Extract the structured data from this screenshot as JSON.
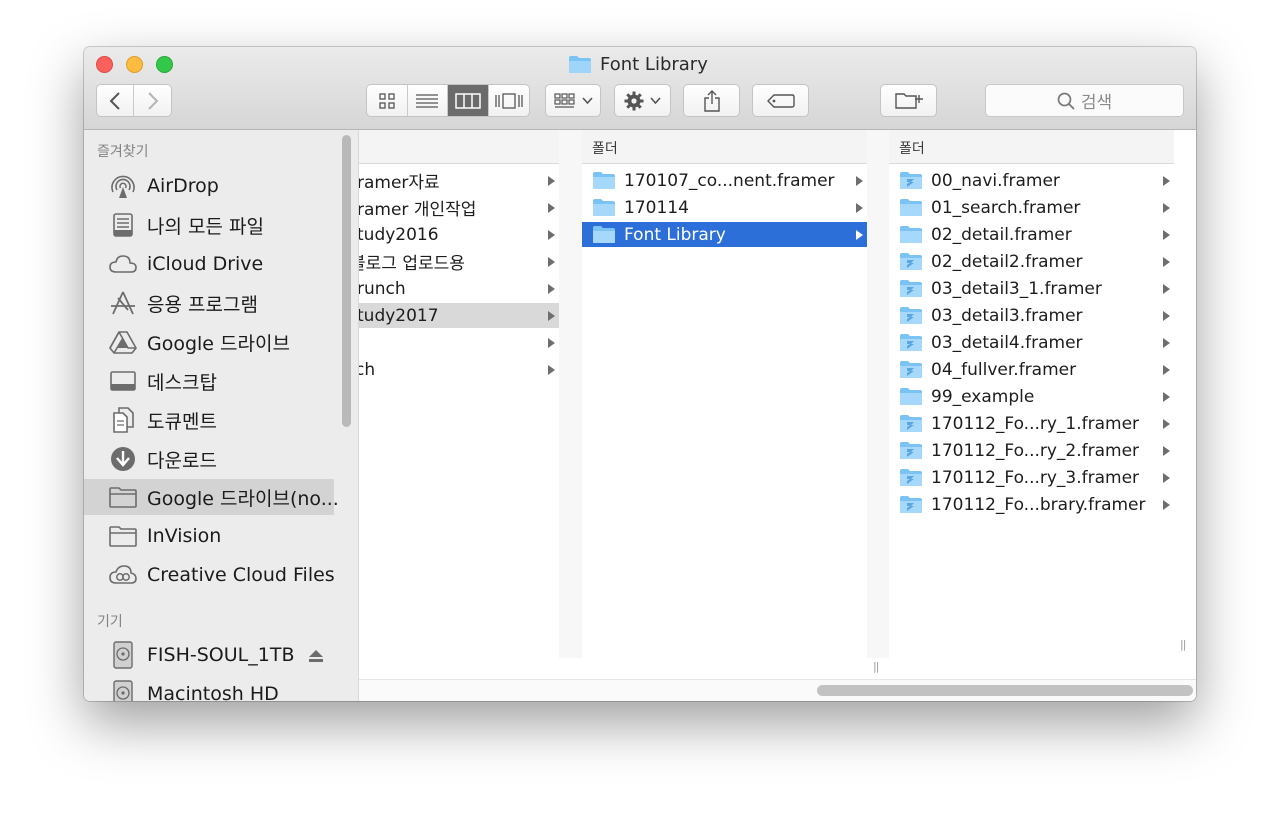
{
  "window": {
    "title": "Font Library"
  },
  "toolbar": {
    "search_placeholder": "검색",
    "view_modes": [
      "icon-view",
      "list-view",
      "column-view",
      "cover-flow-view"
    ],
    "active_view": "column-view"
  },
  "sidebar": {
    "favorites_header": "즐겨찾기",
    "favorites": [
      {
        "label": "AirDrop",
        "icon": "airdrop-icon"
      },
      {
        "label": "나의 모든 파일",
        "icon": "all-files-icon"
      },
      {
        "label": "iCloud Drive",
        "icon": "cloud-icon"
      },
      {
        "label": "응용 프로그램",
        "icon": "applications-icon"
      },
      {
        "label": "Google 드라이브",
        "icon": "google-drive-icon"
      },
      {
        "label": "데스크탑",
        "icon": "desktop-icon"
      },
      {
        "label": "도큐멘트",
        "icon": "documents-icon"
      },
      {
        "label": "다운로드",
        "icon": "download-icon"
      },
      {
        "label": "Google 드라이브(no...",
        "icon": "folder-icon",
        "selected": true
      },
      {
        "label": "InVision",
        "icon": "folder-icon"
      },
      {
        "label": "Creative Cloud Files",
        "icon": "creative-cloud-icon"
      }
    ],
    "devices_header": "기기",
    "devices": [
      {
        "label": "FISH-SOUL_1TB",
        "icon": "disk-icon",
        "eject": true
      },
      {
        "label": "Macintosh HD",
        "icon": "disk-icon"
      }
    ]
  },
  "columns": {
    "col1": {
      "items": [
        {
          "name": "ramer자료"
        },
        {
          "name": "ramer 개인작업"
        },
        {
          "name": "tudy2016"
        },
        {
          "name": "블로그 업로드용"
        },
        {
          "name": "runch"
        },
        {
          "name": "tudy2017",
          "selected": true
        },
        {
          "name": ""
        },
        {
          "name": "ch"
        }
      ]
    },
    "col2": {
      "header": "폴더",
      "items": [
        {
          "name": "170107_co...nent.framer"
        },
        {
          "name": "170114"
        },
        {
          "name": "Font Library",
          "selected": true
        }
      ]
    },
    "col3": {
      "header": "폴더",
      "items": [
        {
          "name": "00_navi.framer",
          "type": "framer"
        },
        {
          "name": "01_search.framer",
          "type": "folder"
        },
        {
          "name": "02_detail.framer",
          "type": "folder"
        },
        {
          "name": "02_detail2.framer",
          "type": "framer"
        },
        {
          "name": "03_detail3_1.framer",
          "type": "framer"
        },
        {
          "name": "03_detail3.framer",
          "type": "framer"
        },
        {
          "name": "03_detail4.framer",
          "type": "framer"
        },
        {
          "name": "04_fullver.framer",
          "type": "framer"
        },
        {
          "name": "99_example",
          "type": "folder"
        },
        {
          "name": "170112_Fo...ry_1.framer",
          "type": "framer"
        },
        {
          "name": "170112_Fo...ry_2.framer",
          "type": "framer"
        },
        {
          "name": "170112_Fo...ry_3.framer",
          "type": "framer"
        },
        {
          "name": "170112_Fo...brary.framer",
          "type": "framer"
        }
      ]
    }
  }
}
